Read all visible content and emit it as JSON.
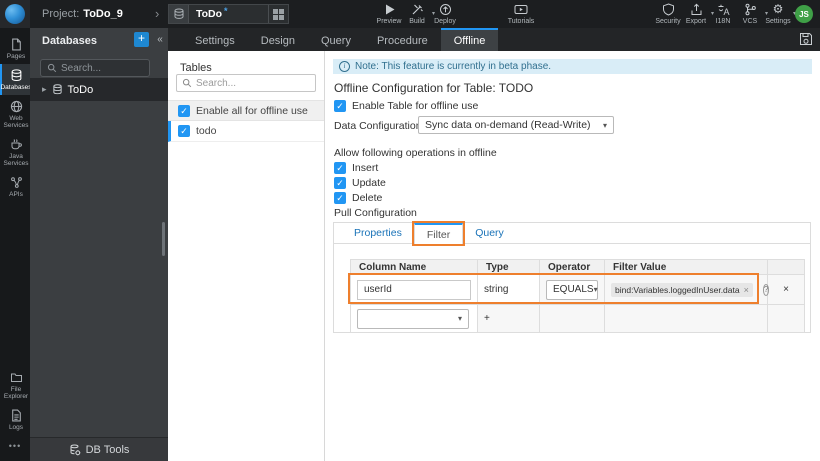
{
  "topbar": {
    "project_label": "Project:",
    "project_name": "ToDo_9",
    "doc_tab": {
      "label": "ToDo",
      "dirty_marker": "*"
    },
    "actions_left": [
      {
        "label": "Preview"
      },
      {
        "label": "Build"
      },
      {
        "label": "Deploy"
      },
      {
        "label": "Tutorials"
      }
    ],
    "actions_right": [
      {
        "label": "Security"
      },
      {
        "label": "Export"
      },
      {
        "label": "I18N"
      },
      {
        "label": "VCS"
      },
      {
        "label": "Settings"
      }
    ],
    "avatar": "JS"
  },
  "iconbar": {
    "items": [
      {
        "label": "Pages"
      },
      {
        "label": "Databases"
      },
      {
        "label": "Web Services"
      },
      {
        "label": "Java Services"
      },
      {
        "label": "APIs"
      }
    ],
    "bottom_items": [
      {
        "label": "File Explorer"
      },
      {
        "label": "Logs"
      }
    ],
    "more": "•••"
  },
  "db_panel": {
    "title": "Databases",
    "search_placeholder": "Search...",
    "tree_item": "ToDo",
    "footer": "DB Tools"
  },
  "editor_tabs": {
    "items": [
      {
        "label": "Settings"
      },
      {
        "label": "Design"
      },
      {
        "label": "Query"
      },
      {
        "label": "Procedure"
      },
      {
        "label": "Offline"
      }
    ]
  },
  "tables_panel": {
    "title": "Tables",
    "search_placeholder": "Search...",
    "enable_all_label": "Enable all for offline use",
    "table_name": "todo"
  },
  "offline": {
    "note": "Note: This feature is currently in beta phase.",
    "heading": "Offline Configuration for Table: TODO",
    "enable_table_label": "Enable Table for offline use",
    "data_config_label": "Data Configuration",
    "data_config_value": "Sync data on-demand (Read-Write)",
    "operations_label": "Allow following operations in offline",
    "operations": [
      {
        "label": "Insert"
      },
      {
        "label": "Update"
      },
      {
        "label": "Delete"
      }
    ],
    "pull_config_label": "Pull Configuration",
    "pull_tabs": [
      {
        "label": "Properties"
      },
      {
        "label": "Filter"
      },
      {
        "label": "Query"
      }
    ],
    "filter_table": {
      "headers": [
        "Column Name",
        "Type",
        "Operator",
        "Filter Value"
      ],
      "row": {
        "column_name": "userId",
        "type": "string",
        "operator": "EQUALS",
        "filter_value": "bind:Variables.loggedInUser.data"
      }
    }
  },
  "icons": {
    "check": "✓",
    "caret_down": "▾",
    "collapse": "«",
    "breadcrumb_chevron": "›",
    "tree_caret": "▸",
    "close": "×",
    "plus": "+",
    "gear": "⚙",
    "question": "?",
    "info": "i"
  },
  "colors": {
    "accent_blue": "#2196f3",
    "highlight_orange": "#ee7f2d",
    "note_bg": "#d9edf7",
    "avatar_green": "#3fa047"
  }
}
